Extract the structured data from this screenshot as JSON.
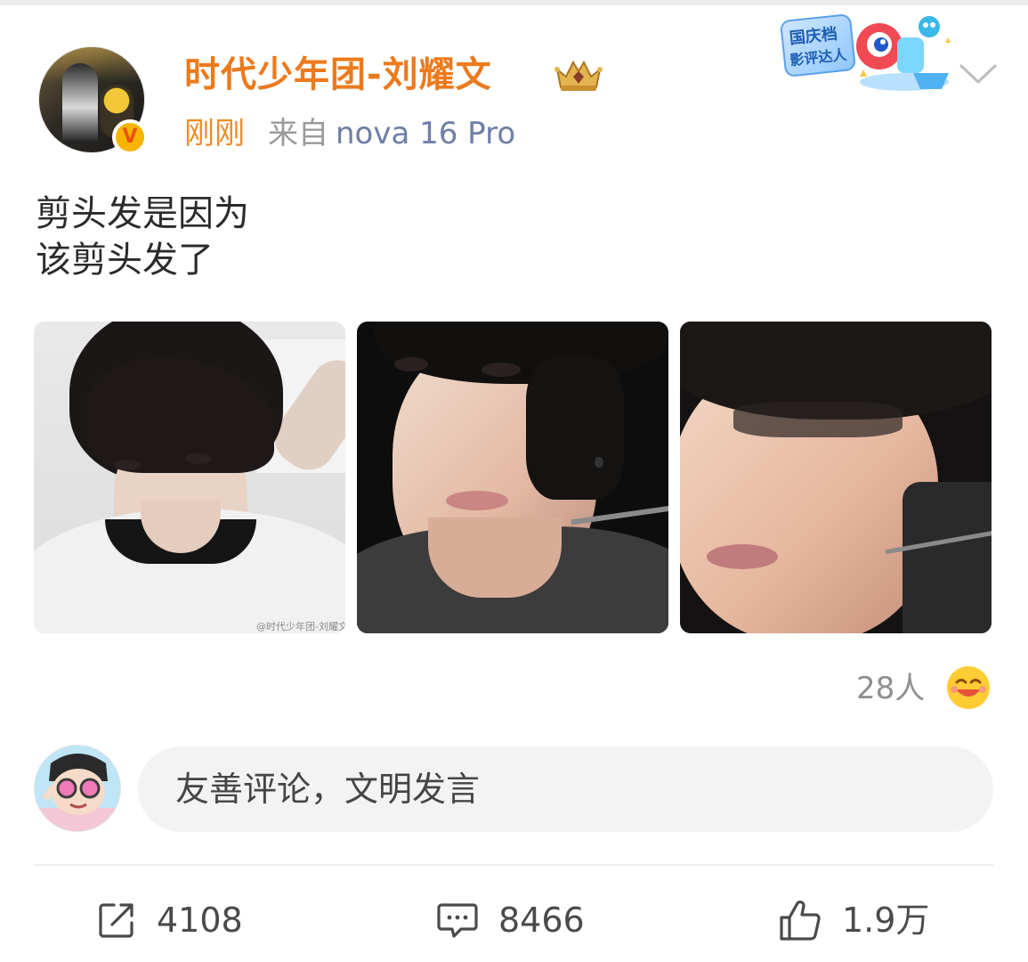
{
  "post": {
    "username": "时代少年团-刘耀文",
    "time": "刚刚",
    "source_label": "来自",
    "device": "nova 16 Pro",
    "verified_mark": "V",
    "text_lines": [
      "剪头发是因为",
      "该剪头发了"
    ],
    "photos": [
      "photo-1",
      "photo-2",
      "photo-3"
    ],
    "watermark": "@时代少年团-刘耀文"
  },
  "badge": {
    "campaign_line1": "国庆档",
    "campaign_line2": "影评达人"
  },
  "reactions": {
    "count": "28人",
    "emoji": "laughing-emoji"
  },
  "comment": {
    "placeholder": "友善评论，文明发言"
  },
  "actions": {
    "repost_count": "4108",
    "comment_count": "8466",
    "like_count": "1.9万"
  },
  "colors": {
    "username": "#ec7a1d",
    "time": "#f08b28",
    "device": "#6e7ea6",
    "text": "#2b2b2b"
  }
}
